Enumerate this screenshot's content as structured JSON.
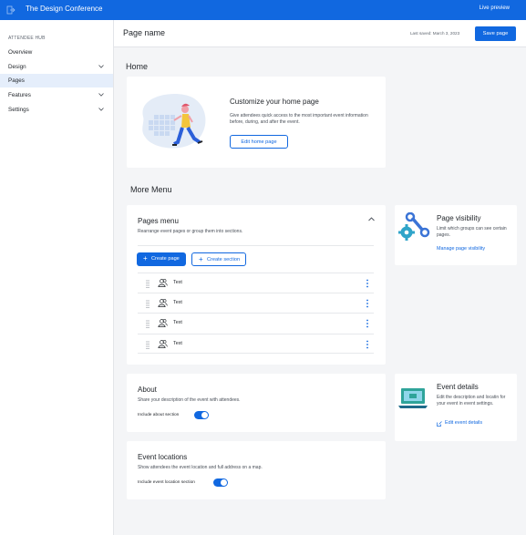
{
  "topbar": {
    "app_title": "The Design Conference",
    "live_preview_label": "Live preview",
    "logo_icon": "exit-icon"
  },
  "sidebar": {
    "section_label": "ATTENDEE HUB",
    "items": [
      {
        "label": "Overview",
        "expandable": false,
        "active": false
      },
      {
        "label": "Design",
        "expandable": true,
        "active": false
      },
      {
        "label": "Pages",
        "expandable": false,
        "active": true
      },
      {
        "label": "Features",
        "expandable": true,
        "active": false
      },
      {
        "label": "Settings",
        "expandable": true,
        "active": false
      }
    ]
  },
  "header": {
    "page_name": "Page name",
    "last_saved": "Last saved: March 3, 2023",
    "save_label": "Save page"
  },
  "home": {
    "section_title": "Home",
    "card_title": "Customize your home page",
    "card_desc": "Give attendees quick access to the most important event information before, during, and after the event.",
    "edit_label": "Edit home page"
  },
  "more_menu": {
    "section_title": "More Menu",
    "pages_menu": {
      "title": "Pages menu",
      "desc": "Rearrange event pages or group them into sections.",
      "create_page_label": "Create page",
      "create_section_label": "Create section",
      "rows": [
        {
          "text": "Text"
        },
        {
          "text": "Text"
        },
        {
          "text": "Text"
        },
        {
          "text": "Text"
        }
      ]
    },
    "visibility": {
      "title": "Page visibility",
      "desc": "Limit which groups can see certain pages.",
      "link_label": "Manage page visibility"
    }
  },
  "about": {
    "title": "About",
    "desc": "Share your description of the event with attendees.",
    "toggle_label": "Include about section",
    "toggle_on": true
  },
  "event_details": {
    "title": "Event details",
    "desc": "Edit the description and locatin for your event in event settings.",
    "link_label": "Edit event details"
  },
  "event_locations": {
    "title": "Event locations",
    "desc": "Show attendees the event location and full address on a map.",
    "toggle_label": "Include event location section",
    "toggle_on": true
  },
  "colors": {
    "accent": "#1168e0",
    "active_nav": "#e5eefb",
    "background": "#f4f5f7"
  }
}
